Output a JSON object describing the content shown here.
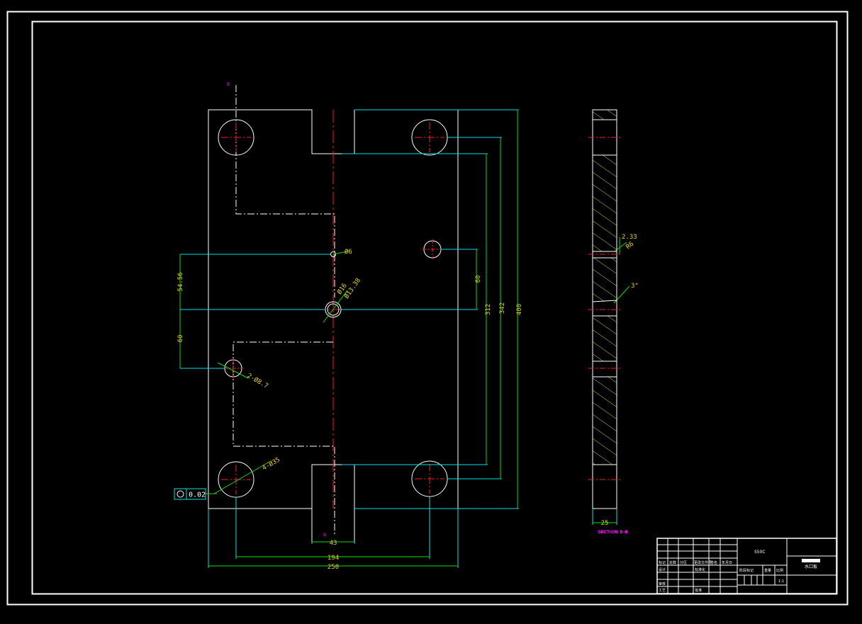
{
  "colors": {
    "background": "#000000",
    "outline": "#ffffff",
    "centerline": "#ff1a1a",
    "dimension": "#00e000",
    "extension": "#00e0e0",
    "dim_text": "#e8d600",
    "section_label": "#ff00ff",
    "hatch": "#e8e800"
  },
  "labels": {
    "sec_top": "B",
    "sec_bottom": "B",
    "section_label": "SECTION B-B"
  },
  "dims": {
    "width_total": "250",
    "hole_pitch": "194",
    "slot_width": "43",
    "height_total": "400",
    "pitch_342": "342",
    "pitch_312": "312",
    "right_60": "60",
    "left_54": "54.56",
    "left_60": "60",
    "hole_d6": "Ø6",
    "hole_d16": "Ø16",
    "hole_d13": "Ø13.38",
    "hole_d87": "2-Ø8.7",
    "hole_4x": "4-Ø35",
    "flatness": "0.02",
    "side_thickness": "25",
    "side_233": "2.33",
    "side_r6": "R6",
    "side_angle": "3°"
  },
  "title_block": {
    "material": "S50C",
    "part_name": "水口板",
    "scale": "1:1",
    "row1": [
      "标记",
      "处数",
      "分区",
      "更改文件号",
      "签名",
      "年月日"
    ],
    "row2": [
      "设计",
      "",
      "标准化",
      "",
      "阶段标记",
      "重量",
      "比例"
    ],
    "row3": [
      "审核",
      "",
      "",
      ""
    ],
    "row4": [
      "工艺",
      "",
      "批准",
      ""
    ]
  }
}
